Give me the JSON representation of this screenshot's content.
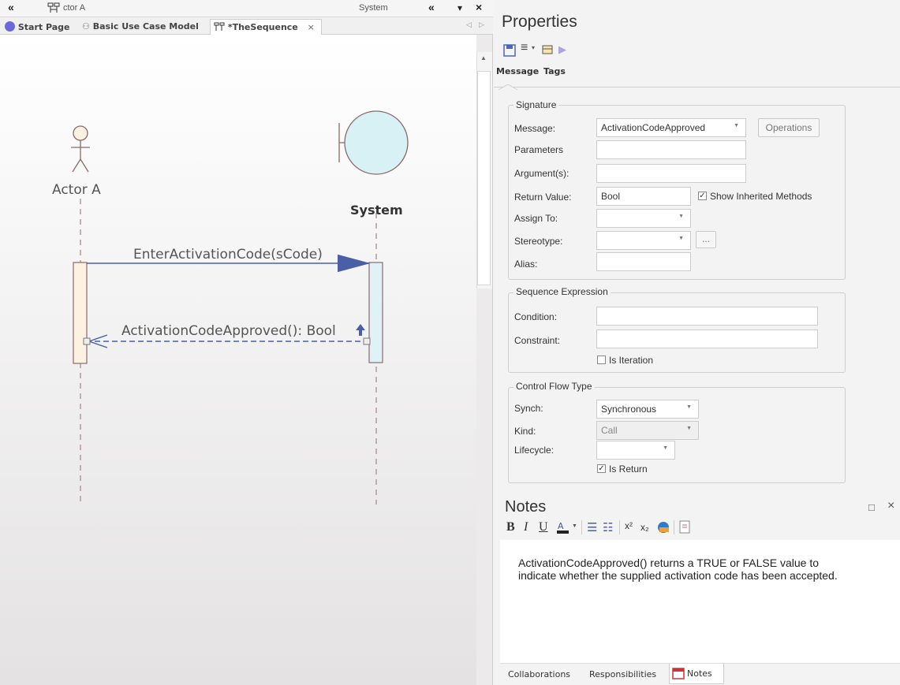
{
  "topbar": {
    "left_arrow": "«",
    "breadcrumb": "ctor A",
    "system": "System",
    "collapse": "«",
    "dropdown": "▾",
    "close": "×"
  },
  "tabs": [
    {
      "label": "Start Page"
    },
    {
      "label": "Basic Use Case Model"
    },
    {
      "label": "*TheSequence"
    }
  ],
  "tab_close": "×",
  "tab_nav_left": "◁",
  "tab_nav_right": "▷",
  "diagram": {
    "actor_label": "Actor A",
    "system_label": "System",
    "message1": "EnterActivationCode(sCode)",
    "message2": "ActivationCodeApproved(): Bool"
  },
  "properties": {
    "title": "Properties",
    "tabs": [
      "Message",
      "Tags"
    ],
    "signature": {
      "legend": "Signature",
      "message_label": "Message:",
      "message_value": "ActivationCodeApproved",
      "operations_button": "Operations",
      "parameters_label": "Parameters",
      "parameters_value": "",
      "arguments_label": "Argument(s):",
      "arguments_value": "",
      "return_label": "Return Value:",
      "return_value": "Bool",
      "show_inherited_label": "Show Inherited Methods",
      "assign_label": "Assign To:",
      "assign_value": "",
      "stereotype_label": "Stereotype:",
      "stereotype_value": "",
      "ellipsis": "...",
      "alias_label": "Alias:",
      "alias_value": ""
    },
    "sequence": {
      "legend": "Sequence Expression",
      "condition_label": "Condition:",
      "condition_value": "",
      "constraint_label": "Constraint:",
      "constraint_value": "",
      "is_iteration_label": "Is Iteration"
    },
    "control": {
      "legend": "Control Flow Type",
      "synch_label": "Synch:",
      "synch_value": "Synchronous",
      "kind_label": "Kind:",
      "kind_value": "Call",
      "lifecycle_label": "Lifecycle:",
      "lifecycle_value": "",
      "is_return_label": "Is Return"
    }
  },
  "notes": {
    "title": "Notes",
    "toolbar": {
      "bold": "B",
      "italic": "I",
      "underline": "U",
      "superscript": "x²",
      "subscript": "x₂"
    },
    "text_line1": "ActivationCodeApproved() returns a TRUE or FALSE value to",
    "text_line2": "indicate whether the supplied activation code has been accepted.",
    "window_icon": "□",
    "close": "×"
  },
  "bottom_tabs": [
    "Collaborations",
    "Responsibilities",
    "Notes"
  ],
  "colors": {
    "accent": "#4a5fa8",
    "activation_left": "#fdf2e2",
    "activation_right": "#dff3f6",
    "boundary_fill": "#d8f1f4",
    "lifeline": "#b19898"
  }
}
